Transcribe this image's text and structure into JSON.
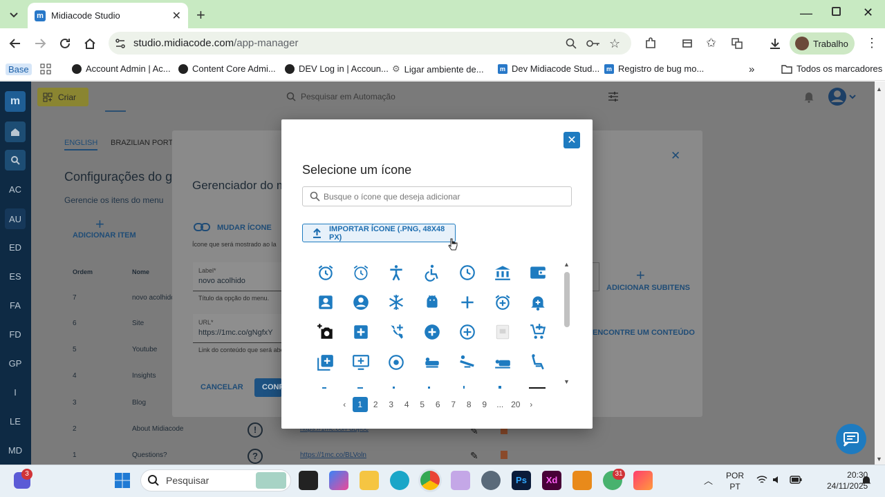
{
  "browser": {
    "tab_title": "Midiacode Studio",
    "url_host": "studio.midiacode.com",
    "url_path": "/app-manager",
    "profile_label": "Trabalho",
    "bookmarks": [
      "Base",
      "Account Admin | Ac...",
      "Content Core Admi...",
      "DEV Log in | Accoun...",
      "Ligar ambiente de...",
      "Dev Midiacode Stud...",
      "Registro de bug mo...",
      "Todos os marcadores"
    ]
  },
  "sidebar": {
    "logo": "m",
    "items": [
      "AC",
      "AU",
      "ED",
      "ES",
      "FA",
      "FD",
      "GP",
      "I",
      "LE",
      "MD"
    ]
  },
  "app": {
    "create_label": "Criar",
    "search_placeholder": "Pesquisar em Automação"
  },
  "background": {
    "lang_tabs": [
      "ENGLISH",
      "BRAZILIAN PORTU"
    ],
    "heading": "Configurações do g",
    "subheading": "Gerencie os itens do menu",
    "add_item": "ADICIONAR ITEM",
    "columns": [
      "Ordem",
      "Nome"
    ],
    "rows": [
      {
        "order": "7",
        "name": "novo acolhido"
      },
      {
        "order": "6",
        "name": "Site"
      },
      {
        "order": "5",
        "name": "Youtube"
      },
      {
        "order": "4",
        "name": "Insights"
      },
      {
        "order": "3",
        "name": "Blog"
      },
      {
        "order": "2",
        "name": "About Midiacode",
        "link": "https://1mc.co/FdBjIoc"
      },
      {
        "order": "1",
        "name": "Questions?",
        "link": "https://1mc.co/BLVoln"
      }
    ]
  },
  "menu_manager": {
    "title": "Gerenciador do m",
    "change_icon": "MUDAR ÍCONE",
    "change_icon_help": "Ícone que será mostrado ao la",
    "label_caption": "Label*",
    "label_value": "novo acolhido",
    "label_help": "Título da opção do menu.",
    "url_caption": "URL*",
    "url_value": "https://1mc.co/gNgfxY",
    "url_help": "Link do conteúdo que será abe",
    "cancel": "CANCELAR",
    "confirm": "CONF",
    "add_subitems": "ADICIONAR SUBITENS",
    "find_content": "ENCONTRE UM CONTEÚDO"
  },
  "icon_modal": {
    "title": "Selecione um ícone",
    "search_placeholder": "Busque o ícone que deseja adicionar",
    "import_label": "IMPORTAR ÍCONE (.PNG, 48X48 PX)",
    "icons": [
      "alarm-icon",
      "alarm-outline-icon",
      "accessibility-icon",
      "accessible-icon",
      "clock-icon",
      "bank-icon",
      "wallet-icon",
      "account-box-icon",
      "account-circle-icon",
      "ac-unit-icon",
      "android-icon",
      "add-icon",
      "add-alarm-icon",
      "add-alert-icon",
      "add-a-photo-icon",
      "add-box-icon",
      "add-call-icon",
      "add-circle-icon",
      "add-circle-outline-icon",
      "broken-image-icon",
      "add-shopping-cart-icon",
      "library-add-icon",
      "add-to-queue-icon",
      "adjust-icon",
      "airline-seat-flat-icon",
      "airline-seat-flat-angled-icon",
      "airline-seat-individual-icon",
      "airline-seat-recline-icon"
    ],
    "pages": [
      "1",
      "2",
      "3",
      "4",
      "5",
      "6",
      "7",
      "8",
      "9",
      "...",
      "20"
    ],
    "current_page": "1"
  },
  "taskbar": {
    "search_placeholder": "Pesquisar",
    "lang": [
      "POR",
      "PT"
    ],
    "time": "20:30",
    "date": "24/11/2025",
    "badge_left": "3",
    "badge_app": "31"
  },
  "colors": {
    "accent": "#1e7bc0",
    "tab_strip": "#c8eac2",
    "sidebar": "#0e2a44"
  }
}
